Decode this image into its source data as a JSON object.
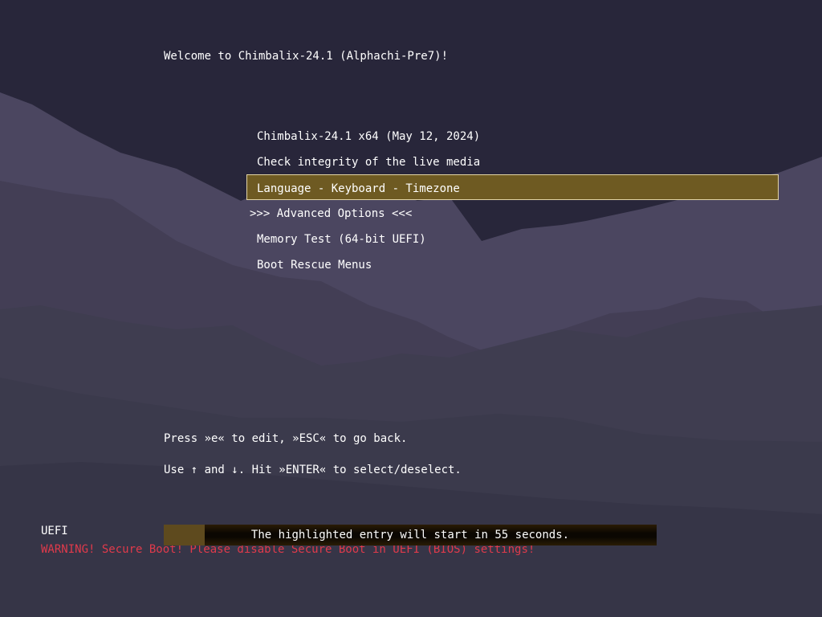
{
  "header": {
    "welcome": "Welcome to Chimbalix-24.1 (Alphachi-Pre7)!"
  },
  "menu": {
    "selected_index": 2,
    "items": [
      {
        "label": "Chimbalix-24.1 x64 (May 12, 2024)"
      },
      {
        "label": "Check integrity of the live media"
      },
      {
        "label": "Language - Keyboard - Timezone"
      },
      {
        "label": ">>> Advanced Options <<<"
      },
      {
        "label": "Memory Test (64-bit UEFI)"
      },
      {
        "label": "Boot Rescue Menus"
      }
    ]
  },
  "help": {
    "line1": "Press »e« to edit, »ESC« to go back.",
    "line2": "Use ↑ and ↓. Hit »ENTER« to select/deselect."
  },
  "footer": {
    "mode": "UEFI",
    "warning": "WARNING! Secure Boot! Please disable Secure Boot in UEFI (BIOS) settings!"
  },
  "timeout": {
    "text": "The highlighted entry will start in 55 seconds.",
    "progress_fraction": 0.083
  },
  "colors": {
    "background": "#28263a",
    "highlight": "#6e5a22",
    "highlight_border": "#e2d4a5",
    "warning": "#e03a4b",
    "text": "#ffffff"
  }
}
